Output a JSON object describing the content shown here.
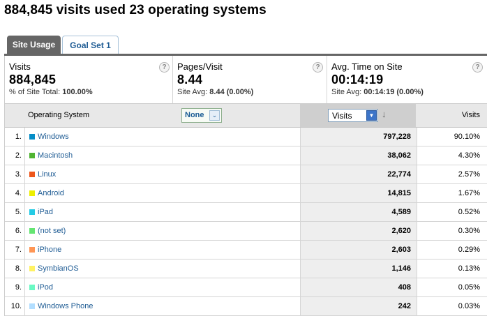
{
  "page": {
    "title": "884,845 visits used 23 operating systems"
  },
  "tabs": [
    {
      "label": "Site Usage"
    },
    {
      "label": "Goal Set 1"
    }
  ],
  "scorecards": [
    {
      "label": "Visits",
      "value": "884,845",
      "sub_prefix": "% of Site Total: ",
      "sub_value": "100.00%"
    },
    {
      "label": "Pages/Visit",
      "value": "8.44",
      "sub_prefix": "Site Avg: ",
      "sub_value": "8.44 (0.00%)"
    },
    {
      "label": "Avg. Time on Site",
      "value": "00:14:19",
      "sub_prefix": "Site Avg: ",
      "sub_value": "00:14:19 (0.00%)"
    }
  ],
  "help_glyph": "?",
  "table": {
    "dimension_header": "Operating System",
    "secondary_dimension": "None",
    "metric_select": "Visits",
    "percent_header": "Visits",
    "rows": [
      {
        "num": "1.",
        "name": "Windows",
        "color": "#058dc7",
        "visits": "797,228",
        "pct": "90.10%"
      },
      {
        "num": "2.",
        "name": "Macintosh",
        "color": "#50b432",
        "visits": "38,062",
        "pct": "4.30%"
      },
      {
        "num": "3.",
        "name": "Linux",
        "color": "#ed561b",
        "visits": "22,774",
        "pct": "2.57%"
      },
      {
        "num": "4.",
        "name": "Android",
        "color": "#edef00",
        "visits": "14,815",
        "pct": "1.67%"
      },
      {
        "num": "5.",
        "name": "iPad",
        "color": "#24cbe5",
        "visits": "4,589",
        "pct": "0.52%"
      },
      {
        "num": "6.",
        "name": "(not set)",
        "color": "#64e572",
        "visits": "2,620",
        "pct": "0.30%"
      },
      {
        "num": "7.",
        "name": "iPhone",
        "color": "#ff9655",
        "visits": "2,603",
        "pct": "0.29%"
      },
      {
        "num": "8.",
        "name": "SymbianOS",
        "color": "#fff263",
        "visits": "1,146",
        "pct": "0.13%"
      },
      {
        "num": "9.",
        "name": "iPod",
        "color": "#6af9c4",
        "visits": "408",
        "pct": "0.05%"
      },
      {
        "num": "10.",
        "name": "Windows Phone",
        "color": "#b2deff",
        "visits": "242",
        "pct": "0.03%"
      }
    ]
  }
}
